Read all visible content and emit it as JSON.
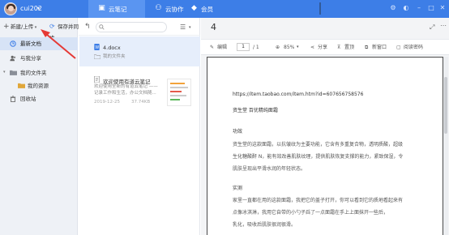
{
  "topbar": {
    "username": "cui202",
    "tabs": [
      {
        "label": "云笔记",
        "icon": "note-icon"
      },
      {
        "label": "云协作",
        "icon": "collab-icon"
      },
      {
        "label": "会员",
        "icon": "diamond-icon"
      }
    ],
    "accent": "#3d7ee7"
  },
  "sidebar": {
    "new_button": "新建/上传",
    "sync_button": "保存并同步",
    "items": [
      {
        "label": "最新文档",
        "icon": "clock-icon"
      },
      {
        "label": "与我分享",
        "icon": "share-people-icon"
      },
      {
        "label": "我的文件夹",
        "icon": "folder-icon"
      },
      {
        "label": "我的资源",
        "icon": "folder-icon"
      },
      {
        "label": "回收站",
        "icon": "trash-icon"
      }
    ]
  },
  "list": {
    "items": [
      {
        "title": "4.docx",
        "folder": "我的文件夹"
      },
      {
        "title": "欢迎使用有道云笔记",
        "desc1": "欢迎使用全新的有道云笔记 ——",
        "desc2": "记录工作和生活，办公文档随...",
        "date": "2019-12-25",
        "size": "37.74KB"
      }
    ]
  },
  "editor": {
    "title": "4",
    "toolbar": {
      "edit": "编辑",
      "page_current": "1",
      "page_total": "/ 1",
      "zoom": "85%",
      "share": "分享",
      "present": "置顶",
      "new_window": "新窗口",
      "read_pwd": "阅读密码"
    },
    "doc": {
      "lines": [
        "https://item.taobao.com/item.htm?id=607656758576",
        "资生堂  百优精纯面霜",
        "功效",
        "资生堂的这款面霜，以抗皱纹为主要功能，它含有多重复合物，透明质酸，超级",
        "生化糖酸酐 N，能有效改善肌肤纹理，提供肌肤恢复支撑的能力，紧致保湿，令",
        "肌肤呈现出平滑水润的年轻状态。",
        "实测",
        "家里一直都在用的这款面霜，我把它的盖子打开，你可以看到它的质地看起来有",
        "点像冰淇淋，我用它自带的小勺子舀了一点面霜在手上上面抹开一些后，",
        "乳化，吸收后肌肤很润很滑。"
      ]
    }
  }
}
